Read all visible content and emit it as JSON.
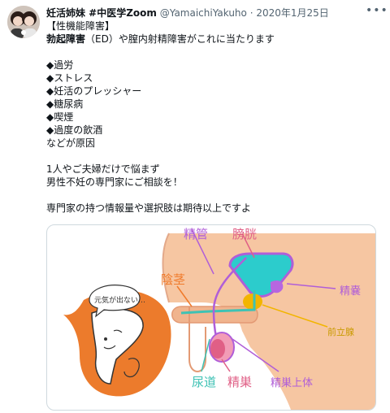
{
  "tweet": {
    "display_name": "妊活姉妹 #中医学Zoom",
    "handle": "@YamaichiYakuho",
    "separator": "·",
    "date": "2020年1月25日",
    "more_icon": "more-horizontal-icon",
    "lines": [
      {
        "text": "【性機能障害】",
        "bold": false
      },
      {
        "text": "勃起障害（ED）や膣内射精障害がこれに当たります",
        "bold": false,
        "bold_prefix": "勃起障害"
      },
      {
        "text": "",
        "bold": false
      },
      {
        "text": "◆過労",
        "bold": false
      },
      {
        "text": "◆ストレス",
        "bold": false
      },
      {
        "text": "◆妊活のプレッシャー",
        "bold": false
      },
      {
        "text": "◆糖尿病",
        "bold": false
      },
      {
        "text": "◆喫煙",
        "bold": false
      },
      {
        "text": "◆過度の飲酒",
        "bold": false
      },
      {
        "text": "などが原因",
        "bold": false
      },
      {
        "text": "",
        "bold": false
      },
      {
        "text": "1人やご夫婦だけで悩まず",
        "bold": false
      },
      {
        "text": "男性不妊の専門家にご相談を！",
        "bold": false
      },
      {
        "text": "",
        "bold": false
      },
      {
        "text": "専門家の持つ情報量や選択肢は期待以上ですよ",
        "bold": false
      }
    ]
  },
  "illustration": {
    "speech_bubble": "元気が出ない…",
    "labels": {
      "vas_deferens": "精管",
      "bladder": "膀胱",
      "penis": "陰茎",
      "seminal_vesicle": "精嚢",
      "prostate": "前立腺",
      "urethra": "尿道",
      "testis": "精巣",
      "epididymis": "精巣上体"
    }
  }
}
